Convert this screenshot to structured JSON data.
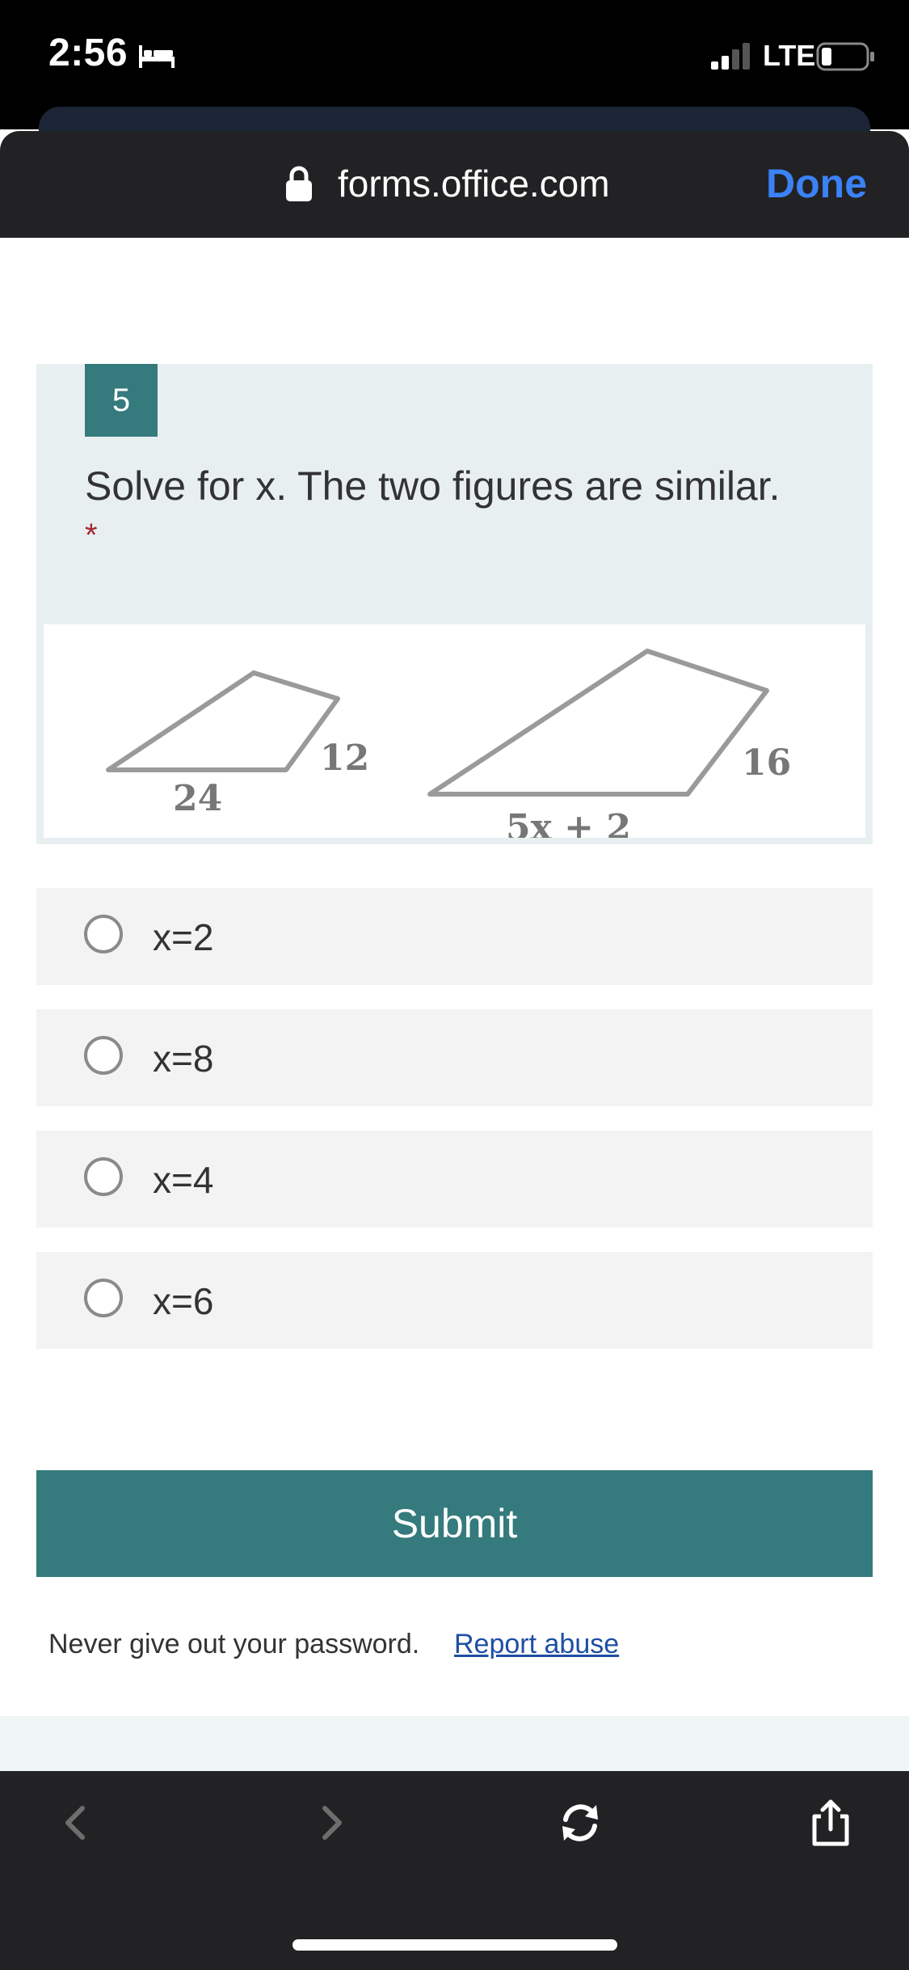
{
  "status_bar": {
    "time": "2:56",
    "network": "LTE",
    "icons": [
      "bed-icon",
      "signal-icon",
      "battery-icon"
    ]
  },
  "browser": {
    "url": "forms.office.com",
    "done_label": "Done",
    "lock_icon": "lock-icon"
  },
  "question": {
    "number": "5",
    "text": "Solve for x. The two figures are similar.",
    "required_mark": "*",
    "figure": {
      "small_side_label": "12",
      "small_base_label": "24",
      "large_side_label": "16",
      "large_base_label": "5x + 2"
    }
  },
  "options": [
    {
      "label": "x=2"
    },
    {
      "label": "x=8"
    },
    {
      "label": "x=4"
    },
    {
      "label": "x=6"
    }
  ],
  "submit_label": "Submit",
  "footer": {
    "note": "Never give out your password.",
    "report_link": "Report abuse"
  },
  "toolbar": {
    "icons": [
      "back-icon",
      "forward-icon",
      "reload-icon",
      "share-icon"
    ]
  },
  "colors": {
    "accent": "#357a7d",
    "done_blue": "#3b82f6",
    "link_blue": "#1e4fa3",
    "required_red": "#a4262c"
  }
}
